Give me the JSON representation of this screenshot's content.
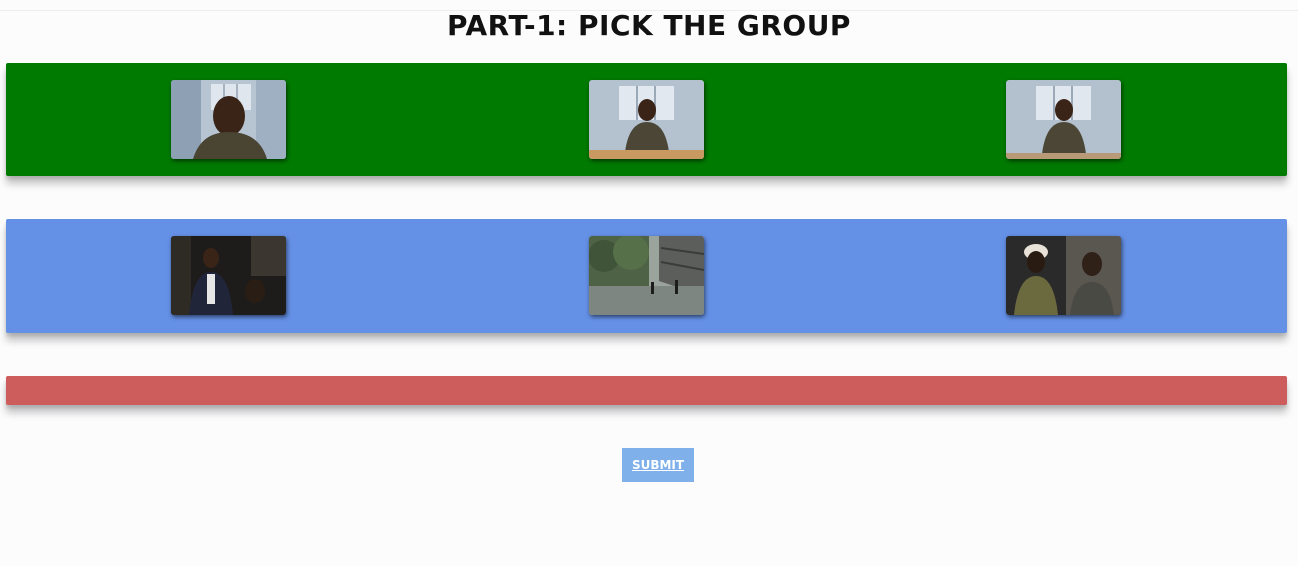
{
  "page": {
    "title": "PART-1: PICK THE GROUP"
  },
  "groups": [
    {
      "color": "#007a00",
      "clips": [
        {
          "icon": "video-thumbnail-man-closeup"
        },
        {
          "icon": "video-thumbnail-man-at-table"
        },
        {
          "icon": "video-thumbnail-man-at-table"
        }
      ]
    },
    {
      "color": "#6490e6",
      "clips": [
        {
          "icon": "video-thumbnail-office-scene"
        },
        {
          "icon": "video-thumbnail-street-scene"
        },
        {
          "icon": "video-thumbnail-two-women"
        }
      ]
    },
    {
      "color": "#cd5c5c",
      "clips": []
    }
  ],
  "submit": {
    "label": "SUBMIT",
    "color": "#7fb0ea"
  }
}
